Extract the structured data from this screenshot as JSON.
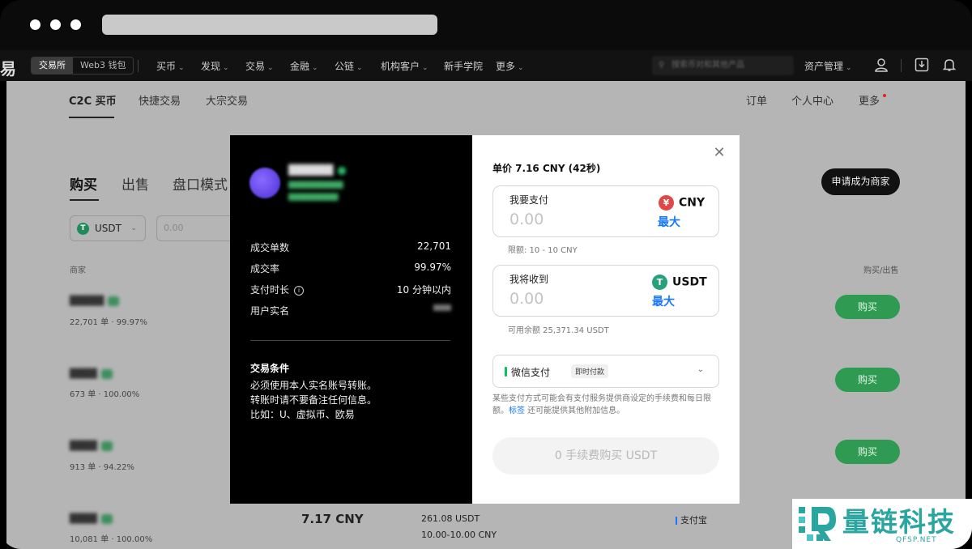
{
  "nav": {
    "brand_char": "易",
    "exchange_tab": "交易所",
    "wallet_tab": "Web3 钱包",
    "items": [
      "买币",
      "发现",
      "交易",
      "金融",
      "公链",
      "机构客户",
      "新手学院",
      "更多"
    ],
    "search_placeholder": "搜索币对和其他产品",
    "asset_menu": "资产管理"
  },
  "subnav": {
    "tabs": [
      "C2C 买币",
      "快捷交易",
      "大宗交易"
    ],
    "right": [
      "订单",
      "个人中心",
      "更多"
    ]
  },
  "market": {
    "tabs": [
      "购买",
      "出售",
      "盘口模式"
    ],
    "apply_button": "申请成为商家",
    "coin": "USDT",
    "amount_placeholder": "0.00",
    "col_merchant": "商家",
    "col_action": "购买/出售",
    "buy_label": "购买",
    "rows": [
      {
        "name": "█████",
        "stats": "22,701 单 · 99.97%"
      },
      {
        "name": "████",
        "stats": "673 单 · 100.00%"
      },
      {
        "name": "████",
        "stats": "913 单 · 94.22%"
      },
      {
        "name": "████",
        "stats": "10,081 单 · 100.00%",
        "price": "7.17 CNY",
        "available": "261.08 USDT",
        "limit": "10.00-10.00 CNY",
        "payment": "支付宝"
      }
    ]
  },
  "merchant": {
    "name": "██████",
    "sub1": "███████████",
    "sub2": "██████████",
    "stats": [
      {
        "label": "成交单数",
        "value": "22,701"
      },
      {
        "label": "成交率",
        "value": "99.97%"
      },
      {
        "label": "支付时长",
        "value": "10 分钟以内"
      },
      {
        "label": "用户实名",
        "value": ""
      }
    ],
    "terms_title": "交易条件",
    "terms": [
      "必须使用本人实名账号转账。",
      "转账时请不要备注任何信息。",
      "比如：U、虚拟币、欧易"
    ]
  },
  "order": {
    "unit_price": "单价 7.16 CNY (42秒)",
    "pay_label": "我要支付",
    "pay_value": "0.00",
    "pay_currency": "CNY",
    "pay_currency_symbol": "¥",
    "max_label": "最大",
    "limit_hint": "限额: 10 - 10 CNY",
    "receive_label": "我将收到",
    "receive_value": "0.00",
    "receive_currency": "USDT",
    "receive_currency_symbol": "T",
    "balance_hint": "可用余额 25,371.34 USDT",
    "payment_method": "微信支付",
    "payment_badge": "即时付款",
    "disclaimer_pre": "某些支付方式可能会有支付服务提供商设定的手续费和每日限额。",
    "disclaimer_link": "标签",
    "disclaimer_post": " 还可能提供其他附加信息。",
    "submit": "0 手续费购买 USDT"
  },
  "watermark": {
    "cn": "量链科技",
    "en": "QFSP.NET"
  },
  "colors": {
    "accent_blue": "#1677ff",
    "buy_green": "#2e9a52",
    "wechat_green": "#07c160",
    "cny_red": "#e04848",
    "tether_green": "#26a17b"
  }
}
